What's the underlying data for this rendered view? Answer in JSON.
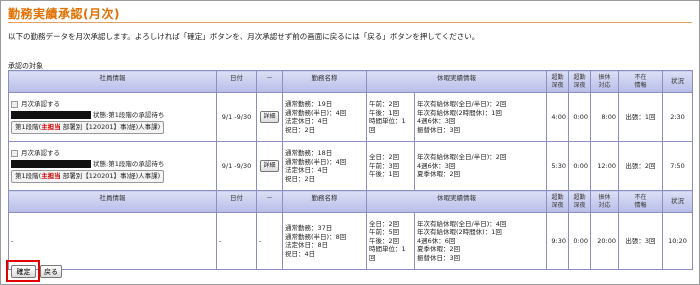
{
  "page": {
    "title": "勤務実績承認(月次)",
    "intro": "以下の勤務データを月次承認します。よろしければ「確定」ボタンを、月次承認せず前の画面に戻るには「戻る」ボタンを押してください。",
    "section_label": "承認の対象"
  },
  "columns": {
    "employee": "社員情報",
    "date": "日付",
    "dash": "－",
    "work_name": "勤務名称",
    "work_leave": "休暇実績情報",
    "overtime_night": "超勤\n深夜",
    "overtime_late": "超勤\n深夜",
    "substitute": "振休\n対応",
    "absence": "不在\n情報",
    "status": "状況"
  },
  "rows": [
    {
      "checkbox_label": "月次承認する",
      "status_text": "状態:第1段階の承認待ち",
      "route_prefix": "第1段階(",
      "route_highlight": "主担当",
      "route_suffix": " 部署別【120201】事)経)人事課)",
      "date": "9/1 -9/30",
      "detail_label": "詳細",
      "work": [
        "通常勤務：19日",
        "通常勤務(半日)：4回",
        "法定休日：4日",
        "祝日：2日"
      ],
      "leave_a": [
        "午前：2回",
        "午後：1回",
        "時間単位：1回"
      ],
      "leave_b": [
        "年次有給休暇(全日/半日)：2回",
        "年次有給休暇(2時間休)：1回",
        "4週6休：3回",
        "振替休日：3回"
      ],
      "ot1": "4:00",
      "ot2": "0:00",
      "sub": "8:00",
      "absence": "出張：1回",
      "state": "2:30"
    },
    {
      "checkbox_label": "月次承認する",
      "status_text": "状態:第1段階の承認待ち",
      "route_prefix": "第1段階(",
      "route_highlight": "主担当",
      "route_suffix": " 部署別【120201】事)経)人事課)",
      "date": "9/1 -9/30",
      "detail_label": "詳細",
      "work": [
        "通常勤務：18日",
        "通常勤務(半日)：4回",
        "法定休日：4日",
        "祝日：2日"
      ],
      "leave_a": [
        "全日：2回",
        "午前：3回",
        "午後：1回"
      ],
      "leave_b": [
        "年次有給休暇(全日/半日)：2回",
        "4週6休：3回",
        "夏季休暇：2回"
      ],
      "ot1": "5:30",
      "ot2": "0:00",
      "sub": "12:00",
      "absence": "出張：2回",
      "state": "7:50"
    }
  ],
  "total": {
    "employee": "-",
    "date": "-",
    "dash": "-",
    "work": [
      "通常勤務：37日",
      "通常勤務(半日)：8回",
      "法定休日：8日",
      "祝日：4日"
    ],
    "leave_a": [
      "全日：2回",
      "午前：5回",
      "午後：2回",
      "時間単位：1回"
    ],
    "leave_b": [
      "年次有給休暇(全日/半日)：4回",
      "年次有給休暇(2時間休)：1回",
      "4週6休：6回",
      "夏季休暇：2回",
      "振替休日：3回"
    ],
    "ot1": "9:30",
    "ot2": "0:00",
    "sub": "20:00",
    "absence": "出張：3回",
    "state": "10:20"
  },
  "buttons": {
    "confirm": "確定",
    "back": "戻る"
  }
}
